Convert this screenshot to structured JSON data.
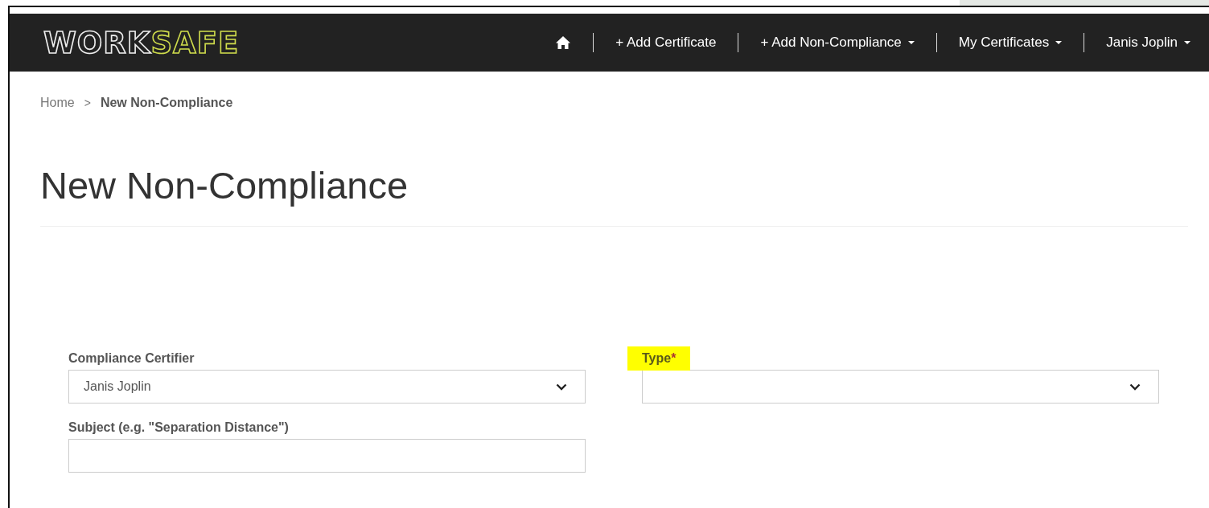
{
  "navbar": {
    "logo": {
      "part_1": "WORK",
      "part_2": "SAFE"
    },
    "items": [
      {
        "kind": "home"
      },
      {
        "kind": "link",
        "label": "+ Add Certificate",
        "dropdown": false
      },
      {
        "kind": "link",
        "label": "+ Add Non-Compliance",
        "dropdown": true
      },
      {
        "kind": "link",
        "label": "My Certificates",
        "dropdown": true
      },
      {
        "kind": "link",
        "label": "Janis Joplin",
        "dropdown": true
      }
    ]
  },
  "breadcrumb": [
    {
      "label": "Home",
      "current": false
    },
    {
      "label": "New Non-Compliance",
      "current": true
    }
  ],
  "breadcrumb_separator": ">",
  "page_title": "New Non-Compliance",
  "form": {
    "rows": [
      [
        {
          "kind": "select",
          "label": "Compliance Certifier",
          "highlighted": false,
          "value": "Janis Joplin"
        },
        {
          "kind": "select",
          "label": "Type",
          "required_mark": "*",
          "highlighted": true
        }
      ],
      [
        {
          "kind": "text",
          "label": "Subject (e.g. \"Separation Distance\")",
          "highlighted": false
        }
      ]
    ]
  }
}
